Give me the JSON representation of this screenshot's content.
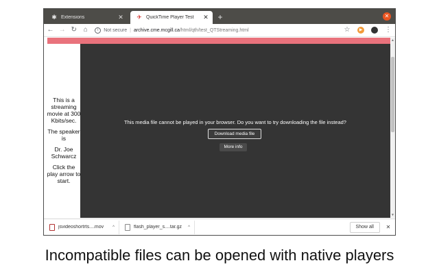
{
  "tabs": [
    {
      "title": "Extensions",
      "icon": "puzzle-icon",
      "active": false
    },
    {
      "title": "QuickTime Player Test",
      "icon": "bird-icon",
      "active": true
    }
  ],
  "toolbar": {
    "security_label": "Not secure",
    "url_host": "archive.cme.mcgill.ca",
    "url_path": "/html/qth/test_QTStreaming.html"
  },
  "page": {
    "sidebar_text": [
      "This is a streaming movie at 300 Kbits/sec.",
      "The speaker is",
      "Dr. Joe Schwarcz",
      "Click the play arrow to start."
    ],
    "player_message": "This media file cannot be played in your browser. Do you want to try downloading the file instead?",
    "download_button": "Download media file",
    "more_info_button": "More info"
  },
  "downloads": [
    {
      "name": "jsvideoshortrts....mov",
      "icon": "video-file-icon"
    },
    {
      "name": "flash_player_s....tar.gz",
      "icon": "archive-file-icon"
    }
  ],
  "shelf": {
    "show_all": "Show all"
  },
  "caption": "Incompatible files can be opened with native players",
  "colors": {
    "accent": "#e95420",
    "player_bg": "#343434",
    "banner": "#e9727c",
    "tabstrip": "#4d4c48"
  }
}
